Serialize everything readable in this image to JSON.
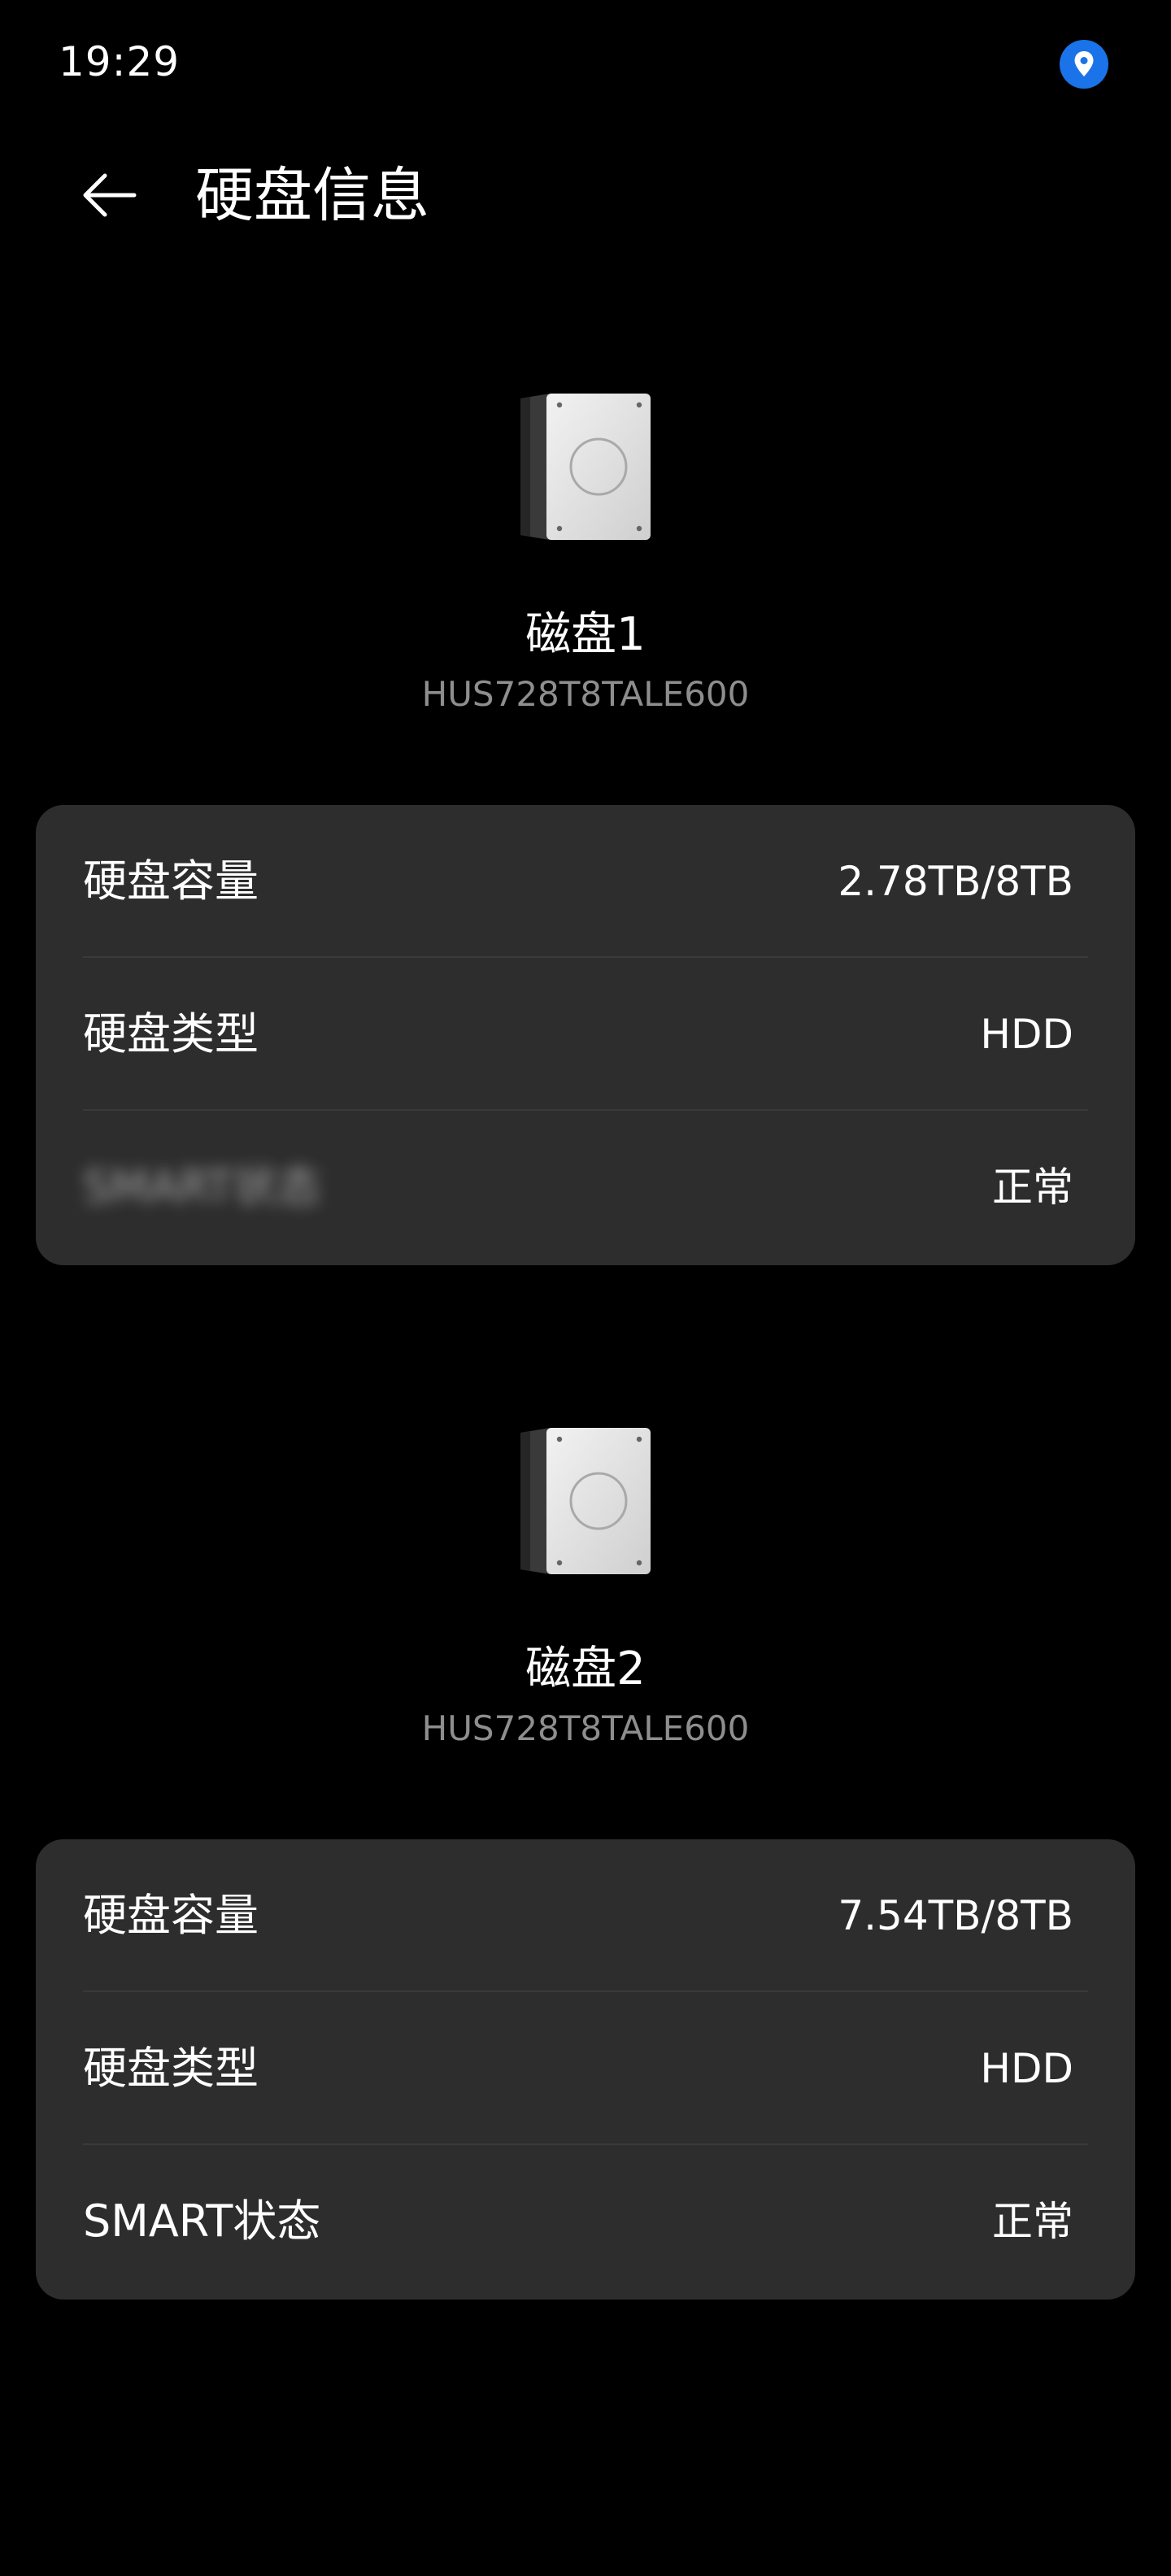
{
  "status_bar": {
    "time": "19:29",
    "location_icon": "location-pin-icon",
    "location_color": "#1a73e8"
  },
  "header": {
    "back_icon": "arrow-left-icon",
    "title": "硬盘信息"
  },
  "disks": [
    {
      "name": "磁盘1",
      "model": "HUS728T8TALE600",
      "rows": [
        {
          "label": "硬盘容量",
          "value": "2.78TB/8TB"
        },
        {
          "label": "硬盘类型",
          "value": "HDD"
        },
        {
          "label": "SMART状态",
          "value": "正常"
        }
      ]
    },
    {
      "name": "磁盘2",
      "model": "HUS728T8TALE600",
      "rows": [
        {
          "label": "硬盘容量",
          "value": "7.54TB/8TB"
        },
        {
          "label": "硬盘类型",
          "value": "HDD"
        },
        {
          "label": "SMART状态",
          "value": "正常"
        }
      ]
    }
  ],
  "colors": {
    "background": "#000000",
    "card": "#2d2d2d",
    "divider": "#3a3a3a",
    "secondary_text": "#8e8e8e"
  }
}
